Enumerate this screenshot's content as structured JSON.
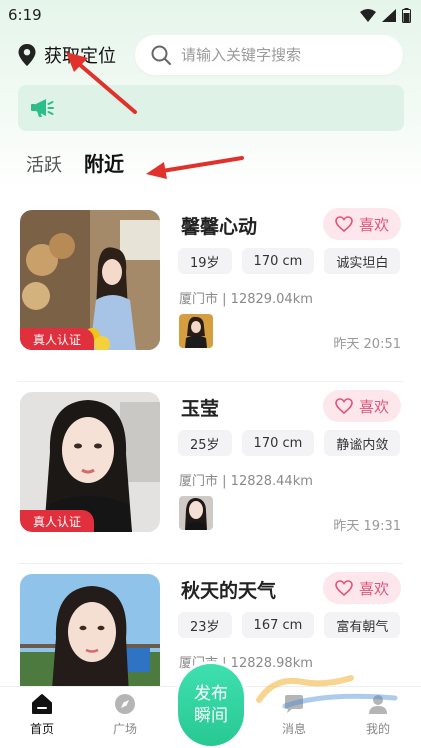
{
  "status_bar": {
    "time": "6:19"
  },
  "header": {
    "location_label": "获取定位",
    "search_placeholder": "请输入关键字搜索"
  },
  "tabs": [
    {
      "label": "活跃",
      "active": false
    },
    {
      "label": "附近",
      "active": true
    }
  ],
  "cards": [
    {
      "name": "馨馨心动",
      "like_label": "喜欢",
      "tags": [
        "19岁",
        "170 cm",
        "诚实坦白"
      ],
      "city": "厦门市",
      "distance": "12829.04km",
      "time": "昨天 20:51",
      "verified_label": "真人认证"
    },
    {
      "name": "玉莹",
      "like_label": "喜欢",
      "tags": [
        "25岁",
        "170 cm",
        "静谧内敛"
      ],
      "city": "厦门市",
      "distance": "12828.44km",
      "time": "昨天 19:31",
      "verified_label": "真人认证"
    },
    {
      "name": "秋天的天气",
      "like_label": "喜欢",
      "tags": [
        "23岁",
        "167 cm",
        "富有朝气"
      ],
      "city": "厦门市",
      "distance": "12828.98km",
      "time": "",
      "verified_label": ""
    }
  ],
  "bottom_nav": {
    "home": "首页",
    "plaza": "广场",
    "publish_line1": "发布",
    "publish_line2": "瞬间",
    "messages": "消息",
    "mine": "我的"
  },
  "colors": {
    "accent_green": "#28c893",
    "like_pink": "#e3547a",
    "verify_red": "#e02f3d",
    "annotation_arrow": "#e0322a"
  },
  "icons": [
    "location-pin-icon",
    "search-icon",
    "megaphone-icon",
    "heart-icon",
    "home-icon",
    "compass-icon",
    "message-icon",
    "user-icon",
    "wifi-icon",
    "signal-icon",
    "battery-icon"
  ]
}
